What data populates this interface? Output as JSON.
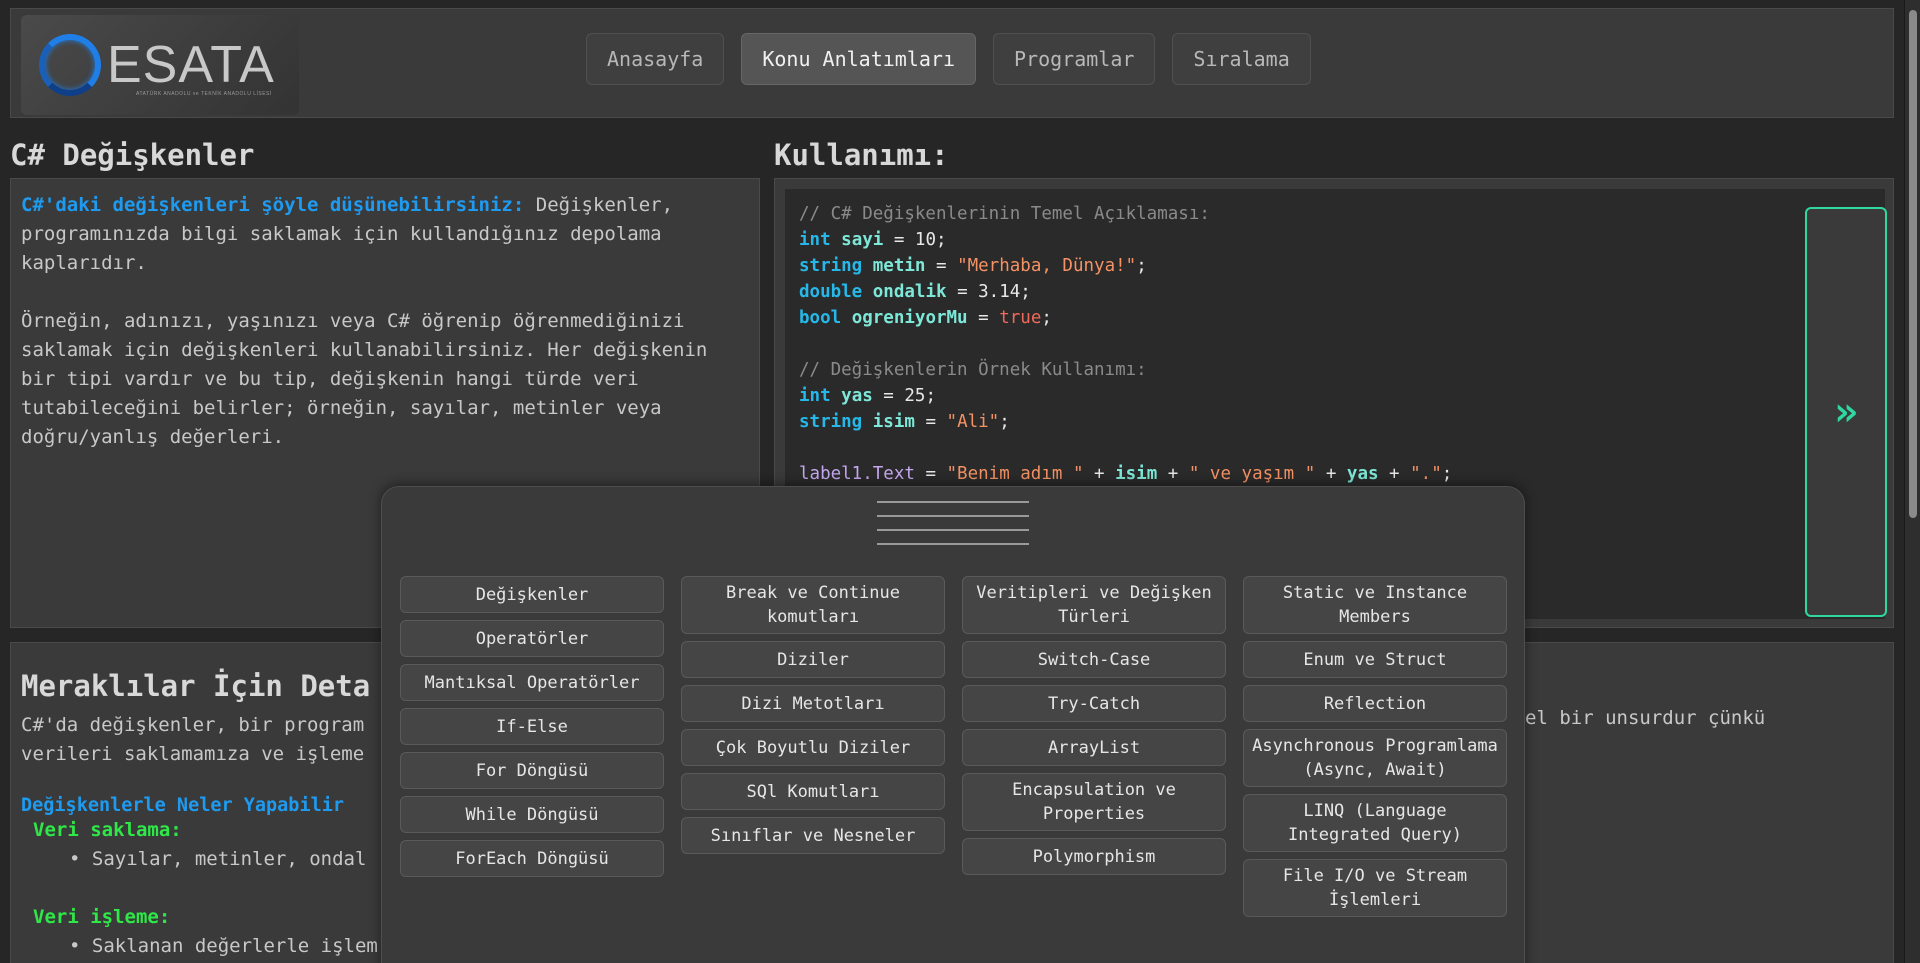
{
  "logo": {
    "text": "ESATA",
    "subtitle": "ATATÜRK ANADOLU ve TEKNİK ANADOLU LİSESİ"
  },
  "nav": [
    {
      "label": "Anasayfa",
      "active": false
    },
    {
      "label": "Konu Anlatımları",
      "active": true
    },
    {
      "label": "Programlar",
      "active": false
    },
    {
      "label": "Sıralama",
      "active": false
    }
  ],
  "left": {
    "title": "C# Değişkenler",
    "highlight": "C#'daki değişkenleri şöyle düşünebilirsiniz:",
    "p1": " Değişkenler, programınızda bilgi saklamak için kullandığınız depolama kaplarıdır.",
    "p2": "Örneğin, adınızı, yaşınızı veya C# öğrenip öğrenmediğinizi saklamak için değişkenleri kullanabilirsiniz. Her değişkenin bir tipi vardır ve bu tip, değişkenin hangi türde veri tutabileceğini belirler; örneğin, sayılar, metinler veya doğru/yanlış değerleri."
  },
  "code_section": {
    "title": "Kullanımı:",
    "comment1": "// C# Değişkenlerinin Temel Açıklaması:",
    "l1": {
      "kw": "int",
      "var": "sayi",
      "op": " = ",
      "val": "10",
      "end": ";"
    },
    "l2": {
      "kw": "string",
      "var": "metin",
      "op": " = ",
      "val": "\"Merhaba, Dünya!\"",
      "end": ";"
    },
    "l3": {
      "kw": "double",
      "var": "ondalik",
      "op": " = ",
      "val": "3.14",
      "end": ";"
    },
    "l4": {
      "kw": "bool",
      "var": "ogreniyorMu",
      "op": " = ",
      "val": "true",
      "end": ";"
    },
    "comment2": "// Değişkenlerin Örnek Kullanımı:",
    "l5": {
      "kw": "int",
      "var": "yas",
      "op": " = ",
      "val": "25",
      "end": ";"
    },
    "l6": {
      "kw": "string",
      "var": "isim",
      "op": " = ",
      "val": "\"Ali\"",
      "end": ";"
    },
    "l7": {
      "obj": "label1.Text",
      "op": " = ",
      "s1": "\"Benim adım \"",
      "plus": " + ",
      "v1": "isim",
      "s2": "\" ve yaşım \"",
      "v2": "yas",
      "s3": "\".\"",
      "end": ";"
    },
    "run_icon": "»"
  },
  "bottom": {
    "title": "Meraklılar İçin Deta",
    "text1": "C#'da değişkenler, bir program",
    "text2": "verileri saklamamıza ve işleme",
    "text_right": "el bir unsurdur çünkü",
    "sub": "Değişkenlerle Neler Yapabilir",
    "h1": "Veri saklama:",
    "b1": "Sayılar, metinler, ondal",
    "h2": "Veri işleme:",
    "b2": "Saklanan değerlerle işlem"
  },
  "menu": {
    "columns": [
      [
        "Değişkenler",
        "Operatörler",
        "Mantıksal Operatörler",
        "If-Else",
        "For Döngüsü",
        "While Döngüsü",
        "ForEach Döngüsü"
      ],
      [
        "Break ve Continue komutları",
        "Diziler",
        "Dizi Metotları",
        "Çok Boyutlu Diziler",
        "SQl Komutları",
        "Sınıflar ve Nesneler"
      ],
      [
        "Veritipleri ve Değişken Türleri",
        "Switch-Case",
        "Try-Catch",
        "ArrayList",
        "Encapsulation ve Properties",
        "Polymorphism"
      ],
      [
        "Static ve Instance Members",
        "Enum ve Struct",
        "Reflection",
        "Asynchronous Programlama (Async, Await)",
        "LINQ (Language Integrated Query)",
        "File I/O ve Stream İşlemleri"
      ]
    ]
  }
}
